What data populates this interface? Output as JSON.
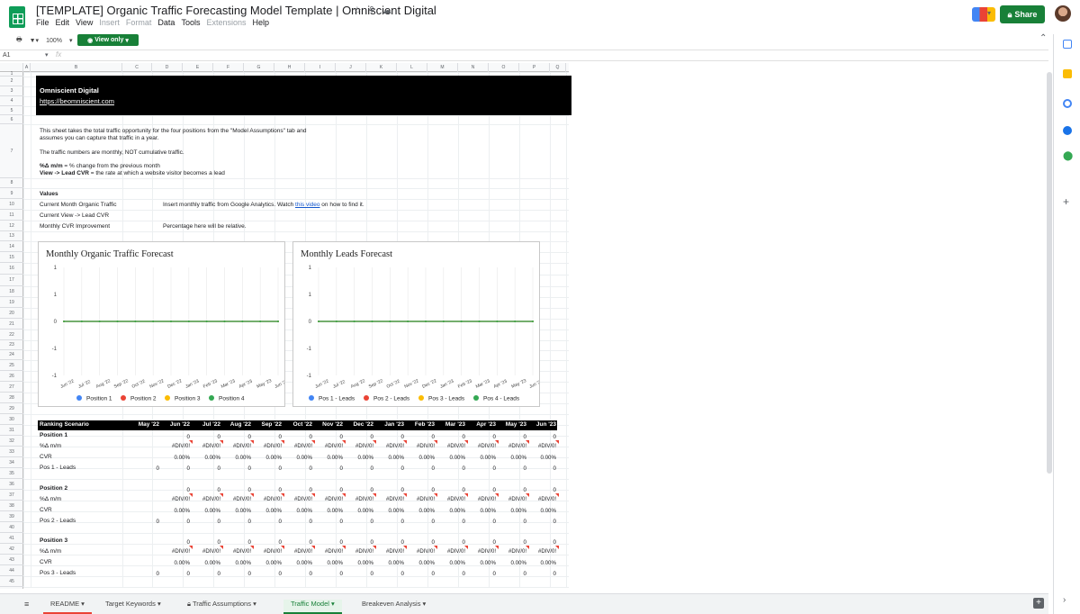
{
  "doc": {
    "title": "[TEMPLATE] Organic Traffic Forecasting Model Template | Omniscient Digital",
    "star": "☆",
    "drive": "⚘",
    "cloud": "☁"
  },
  "menu": [
    "File",
    "Edit",
    "View",
    "Insert",
    "Format",
    "Data",
    "Tools",
    "Extensions",
    "Help"
  ],
  "menu_disabled": [
    "Insert",
    "Format",
    "Extensions"
  ],
  "share_label": "Share",
  "toolbar": {
    "zoom": "100%",
    "view_only": "View only"
  },
  "formula": {
    "namebox": "A1",
    "fx": "fx"
  },
  "columns": [
    "A",
    "B",
    "C",
    "D",
    "E",
    "F",
    "G",
    "H",
    "I",
    "J",
    "K",
    "L",
    "M",
    "N",
    "O",
    "P",
    "Q"
  ],
  "rows": [
    "1",
    "2",
    "3",
    "4",
    "5",
    "6",
    "7",
    "8",
    "9",
    "10",
    "11",
    "12",
    "13",
    "14",
    "15",
    "16",
    "17",
    "18",
    "19",
    "20",
    "21",
    "22",
    "23",
    "24",
    "25",
    "26",
    "27",
    "28",
    "29",
    "30",
    "31",
    "32",
    "33",
    "34",
    "35",
    "36",
    "37",
    "38",
    "39",
    "40",
    "41",
    "42",
    "43",
    "44",
    "45"
  ],
  "banner": {
    "company": "Omniscient Digital",
    "url": "https://beomniscient.com"
  },
  "intro": {
    "line1": "This sheet takes the total traffic opportunity for the four positions from the \"Model Assumptions\" tab and",
    "line2": "assumes you can capture that traffic in a year.",
    "line3": "The traffic numbers are monthly, NOT cumulative traffic.",
    "def1_bold": "%Δ m/m",
    "def1_rest": " = % change from the previous month",
    "def2_bold": "View -> Lead CVR",
    "def2_rest": " = the rate at which a website visitor becomes a lead"
  },
  "values": {
    "header": "Values",
    "r1": "Current Month Organic Traffic",
    "r1_note_a": "Insert monthly traffic from Google Analytics. Watch ",
    "r1_link": "this video",
    "r1_note_b": " on how to find it.",
    "r2": "Current View -> Lead CVR",
    "r3": "Monthly CVR Improvement",
    "r3_note": "Percentage here will be relative."
  },
  "charts": [
    {
      "title": "Monthly Organic Traffic Forecast",
      "legend": [
        "Position 1",
        "Position 2",
        "Position 3",
        "Position 4"
      ]
    },
    {
      "title": "Monthly Leads Forecast",
      "legend": [
        "Pos 1 - Leads",
        "Pos 2 - Leads",
        "Pos 3 - Leads",
        "Pos 4 - Leads"
      ]
    }
  ],
  "chart_data": [
    {
      "type": "line",
      "title": "Monthly Organic Traffic Forecast",
      "x": [
        "Jun '22",
        "Jul '22",
        "Aug '22",
        "Sep '22",
        "Oct '22",
        "Nov '22",
        "Dec '22",
        "Jan '23",
        "Feb '23",
        "Mar '23",
        "Apr '23",
        "May '23",
        "Jun '23"
      ],
      "y_ticks": [
        "1",
        "1",
        "0",
        "-1",
        "-1"
      ],
      "series": [
        {
          "name": "Position 1",
          "values": [
            0,
            0,
            0,
            0,
            0,
            0,
            0,
            0,
            0,
            0,
            0,
            0,
            0
          ]
        },
        {
          "name": "Position 2",
          "values": [
            0,
            0,
            0,
            0,
            0,
            0,
            0,
            0,
            0,
            0,
            0,
            0,
            0
          ]
        },
        {
          "name": "Position 3",
          "values": [
            0,
            0,
            0,
            0,
            0,
            0,
            0,
            0,
            0,
            0,
            0,
            0,
            0
          ]
        },
        {
          "name": "Position 4",
          "values": [
            0,
            0,
            0,
            0,
            0,
            0,
            0,
            0,
            0,
            0,
            0,
            0,
            0
          ]
        }
      ],
      "ylim": [
        -1,
        1
      ],
      "legend": "bottom"
    },
    {
      "type": "line",
      "title": "Monthly Leads Forecast",
      "x": [
        "Jun '22",
        "Jul '22",
        "Aug '22",
        "Sep '22",
        "Oct '22",
        "Nov '22",
        "Dec '22",
        "Jan '23",
        "Feb '23",
        "Mar '23",
        "Apr '23",
        "May '23",
        "Jun '23"
      ],
      "y_ticks": [
        "1",
        "1",
        "0",
        "-1",
        "-1"
      ],
      "series": [
        {
          "name": "Pos 1 - Leads",
          "values": [
            0,
            0,
            0,
            0,
            0,
            0,
            0,
            0,
            0,
            0,
            0,
            0,
            0
          ]
        },
        {
          "name": "Pos 2 - Leads",
          "values": [
            0,
            0,
            0,
            0,
            0,
            0,
            0,
            0,
            0,
            0,
            0,
            0,
            0
          ]
        },
        {
          "name": "Pos 3 - Leads",
          "values": [
            0,
            0,
            0,
            0,
            0,
            0,
            0,
            0,
            0,
            0,
            0,
            0,
            0
          ]
        },
        {
          "name": "Pos 4 - Leads",
          "values": [
            0,
            0,
            0,
            0,
            0,
            0,
            0,
            0,
            0,
            0,
            0,
            0,
            0
          ]
        }
      ],
      "ylim": [
        -1,
        1
      ],
      "legend": "bottom"
    }
  ],
  "series_colors": [
    "#4285f4",
    "#ea4335",
    "#fbbc04",
    "#34a853"
  ],
  "table": {
    "header": "Ranking Scenario",
    "months": [
      "May '22",
      "Jun '22",
      "Jul '22",
      "Aug '22",
      "Sep '22",
      "Oct '22",
      "Nov '22",
      "Dec '22",
      "Jan '23",
      "Feb '23",
      "Mar '23",
      "Apr '23",
      "May '23",
      "Jun '23"
    ],
    "blocks": [
      {
        "title": "Position 1",
        "r_delta": "%Δ m/m",
        "r_cvr": "CVR",
        "r_leads": "Pos 1 - Leads"
      },
      {
        "title": "Position 2",
        "r_delta": "%Δ m/m",
        "r_cvr": "CVR",
        "r_leads": "Pos 2 - Leads"
      },
      {
        "title": "Position 3",
        "r_delta": "%Δ m/m",
        "r_cvr": "CVR",
        "r_leads": "Pos 3 - Leads"
      }
    ],
    "zero": "0",
    "err": "#DIV/0!",
    "pct": "0.00%"
  },
  "tabs": [
    "README",
    "Target Keywords",
    "Traffic Assumptions",
    "Traffic Model",
    "Breakeven Analysis"
  ]
}
